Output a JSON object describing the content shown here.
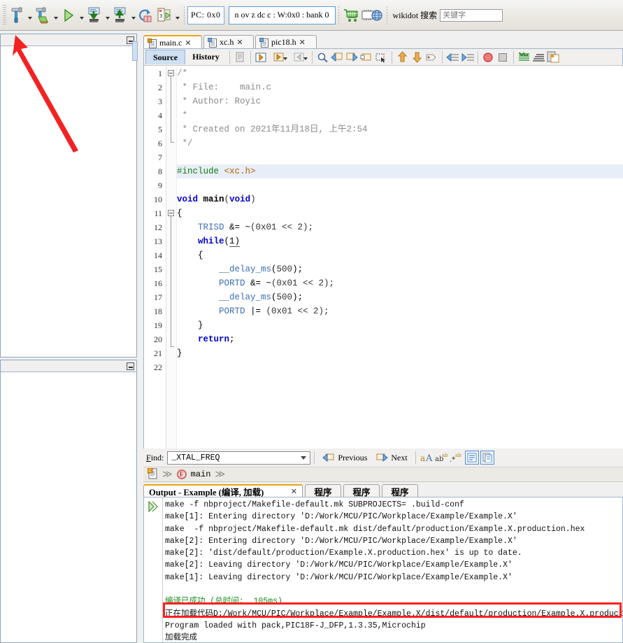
{
  "toolbar": {
    "buttons": [
      {
        "name": "build-project",
        "icon": "hammer-icon"
      },
      {
        "name": "clean-and-build",
        "icon": "hammer-broom-icon"
      },
      {
        "name": "run-project",
        "icon": "green-play-icon"
      },
      {
        "name": "program-device",
        "icon": "download-chip-icon"
      },
      {
        "name": "read-device-memory",
        "icon": "upload-chip-icon"
      },
      {
        "name": "hold-in-reset",
        "icon": "reset-refresh-icon"
      },
      {
        "name": "debug-project",
        "icon": "debug-step-icon"
      }
    ],
    "pc_label": "PC: 0x0",
    "status_flags": "n  ov  z  dc  c     :   W:0x0  :  bank  0",
    "cart_icon": "shopping-cart-icon",
    "chip_icon": "chip-globe-icon",
    "wikidot_label": "wikidot 搜索",
    "search_placeholder": "关键字"
  },
  "left_panels": {
    "top": {
      "name": "projects-panel"
    },
    "bottom": {
      "name": "navigator-panel"
    }
  },
  "editor": {
    "tabs": [
      {
        "label": "main.c",
        "active": true,
        "icon": "c-file-icon"
      },
      {
        "label": "xc.h",
        "active": false,
        "icon": "h-file-icon"
      },
      {
        "label": "pic18.h",
        "active": false,
        "icon": "h-file-icon"
      }
    ],
    "close_glyph": "✕",
    "view_tabs": [
      {
        "label": "Source",
        "selected": true
      },
      {
        "label": "History",
        "selected": false
      }
    ],
    "margin_line_column": 80,
    "highlighted_line": 8,
    "code": [
      {
        "n": 1,
        "text": "/*"
      },
      {
        "n": 2,
        "text": " * File:   main.c"
      },
      {
        "n": 3,
        "text": " * Author: Royic"
      },
      {
        "n": 4,
        "text": " *"
      },
      {
        "n": 5,
        "text": " * Created on 2021年11月18日, 上午2:54"
      },
      {
        "n": 6,
        "text": " */"
      },
      {
        "n": 7,
        "text": ""
      },
      {
        "n": 8,
        "text": "#include <xc.h>"
      },
      {
        "n": 9,
        "text": ""
      },
      {
        "n": 10,
        "text": "void main(void)"
      },
      {
        "n": 11,
        "text": "{"
      },
      {
        "n": 12,
        "text": "    TRISD &= ~(0x01 << 2);"
      },
      {
        "n": 13,
        "text": "    while(1)"
      },
      {
        "n": 14,
        "text": "    {"
      },
      {
        "n": 15,
        "text": "        __delay_ms(500);"
      },
      {
        "n": 16,
        "text": "        PORTD &= ~(0x01 << 2);"
      },
      {
        "n": 17,
        "text": "        __delay_ms(500);"
      },
      {
        "n": 18,
        "text": "        PORTD |= (0x01 << 2);"
      },
      {
        "n": 19,
        "text": "    }"
      },
      {
        "n": 20,
        "text": "    return;"
      },
      {
        "n": 21,
        "text": "}"
      },
      {
        "n": 22,
        "text": ""
      }
    ]
  },
  "find_bar": {
    "label": "Find:",
    "label_accel": "F",
    "value": "_XTAL_FREQ",
    "previous_label": "Previous",
    "next_label": "Next",
    "match_case_icon": "match-case-icon",
    "whole_words_icon": "whole-words-icon",
    "regex_icon": "regex-icon",
    "highlight_icon": "highlight-results-icon",
    "copy_icon": "copy-results-icon"
  },
  "nav_bar": {
    "file_icon": "c-file-icon",
    "member_icon": "function-icon",
    "member_label": "main",
    "separator": "≫"
  },
  "output": {
    "tabs": [
      {
        "label": "Output - Example (编译, 加载)",
        "active": true,
        "closable": true
      },
      {
        "label": "程序",
        "active": false,
        "closable": false
      },
      {
        "label": "程序",
        "active": false,
        "closable": false
      },
      {
        "label": "程序",
        "active": false,
        "closable": false
      }
    ],
    "close_glyph": "✕",
    "run_icon": "run-arrow-icon",
    "lines": [
      {
        "text": "make -f nbproject/Makefile-default.mk SUBPROJECTS= .build-conf",
        "color": "black"
      },
      {
        "text": "make[1]: Entering directory 'D:/Work/MCU/PIC/Workplace/Example/Example.X'",
        "color": "black"
      },
      {
        "text": "make  -f nbproject/Makefile-default.mk dist/default/production/Example.X.production.hex",
        "color": "black"
      },
      {
        "text": "make[2]: Entering directory 'D:/Work/MCU/PIC/Workplace/Example/Example.X'",
        "color": "black"
      },
      {
        "text": "make[2]: 'dist/default/production/Example.X.production.hex' is up to date.",
        "color": "black"
      },
      {
        "text": "make[2]: Leaving directory 'D:/Work/MCU/PIC/Workplace/Example/Example.X'",
        "color": "black"
      },
      {
        "text": "make[1]: Leaving directory 'D:/Work/MCU/PIC/Workplace/Example/Example.X'",
        "color": "black"
      },
      {
        "text": "",
        "color": "black"
      },
      {
        "text": "编译已成功 (总时间:  105ms)",
        "color": "green"
      },
      {
        "text": "正在加载代码D:/Work/MCU/PIC/Workplace/Example/Example.X/dist/default/production/Example.X.production.hex...",
        "color": "black"
      },
      {
        "text": "Program loaded with pack,PIC18F-J_DFP,1.3.35,Microchip",
        "color": "black"
      },
      {
        "text": "加载完成",
        "color": "black"
      }
    ],
    "highlight_box": {
      "name": "loading-code-highlight",
      "color": "#ff1f1f"
    }
  },
  "annotation": {
    "arrow_color": "#f32222",
    "points_to": "build-project-toolbar-button"
  }
}
